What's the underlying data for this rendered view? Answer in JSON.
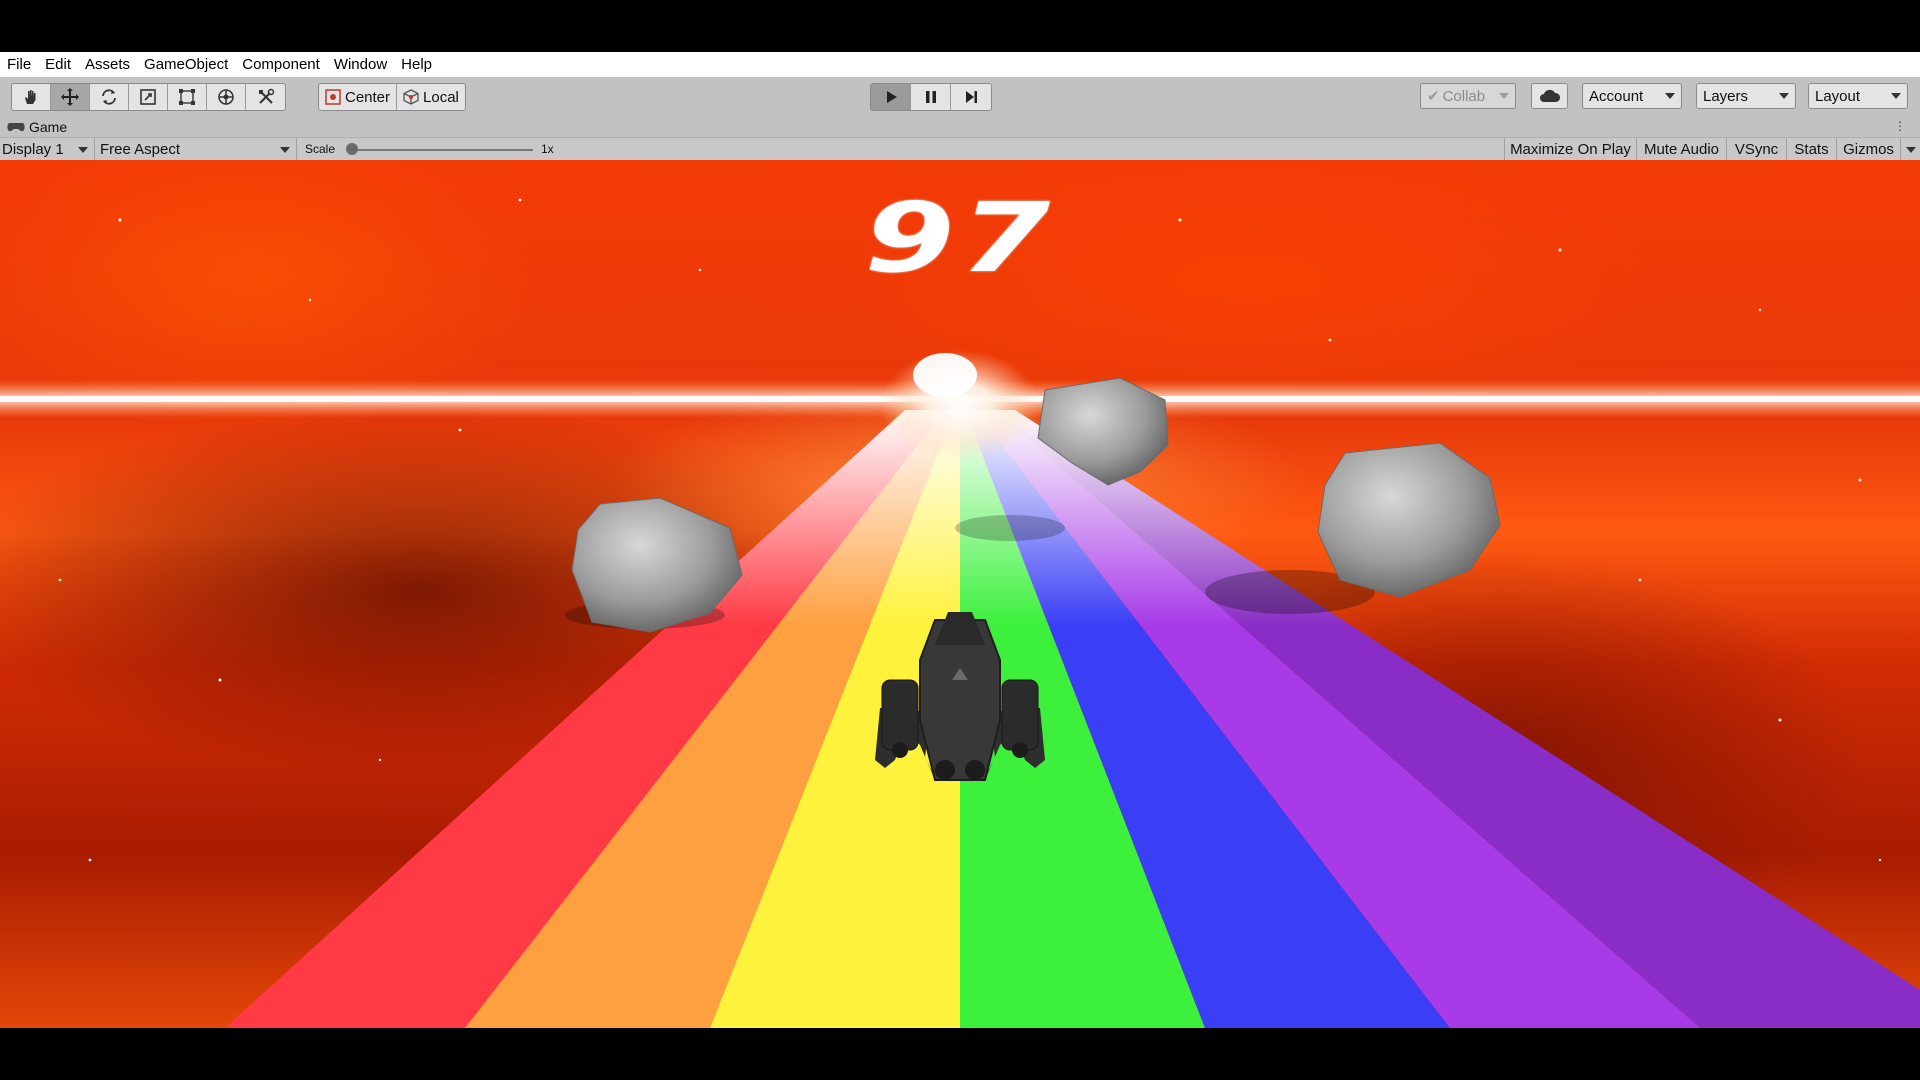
{
  "menu": [
    "File",
    "Edit",
    "Assets",
    "GameObject",
    "Component",
    "Window",
    "Help"
  ],
  "tools": [
    {
      "name": "hand-tool-icon",
      "active": false
    },
    {
      "name": "move-tool-icon",
      "active": true
    },
    {
      "name": "rotate-tool-icon",
      "active": false
    },
    {
      "name": "scale-tool-icon",
      "active": false
    },
    {
      "name": "rect-tool-icon",
      "active": false
    },
    {
      "name": "transform-tool-icon",
      "active": false
    },
    {
      "name": "custom-tool-icon",
      "active": false
    }
  ],
  "pivot": {
    "center_label": "Center",
    "local_label": "Local"
  },
  "playback": {
    "play_active": true
  },
  "right_toolbar": {
    "collab_label": "Collab",
    "account_label": "Account",
    "layers_label": "Layers",
    "layout_label": "Layout"
  },
  "game_view": {
    "tab_label": "Game",
    "display_label": "Display 1",
    "aspect_label": "Free Aspect",
    "scale_label": "Scale",
    "scale_value": "1x",
    "maximize_label": "Maximize On Play",
    "mute_label": "Mute Audio",
    "vsync_label": "VSync",
    "stats_label": "Stats",
    "gizmos_label": "Gizmos"
  },
  "game": {
    "score": "97",
    "lane_colors": [
      "#ff3a44",
      "#ffa040",
      "#fff23c",
      "#3cf03c",
      "#3a3ef5",
      "#a83ae8",
      "#8a2dc6"
    ],
    "background_color": "#e8390a"
  }
}
